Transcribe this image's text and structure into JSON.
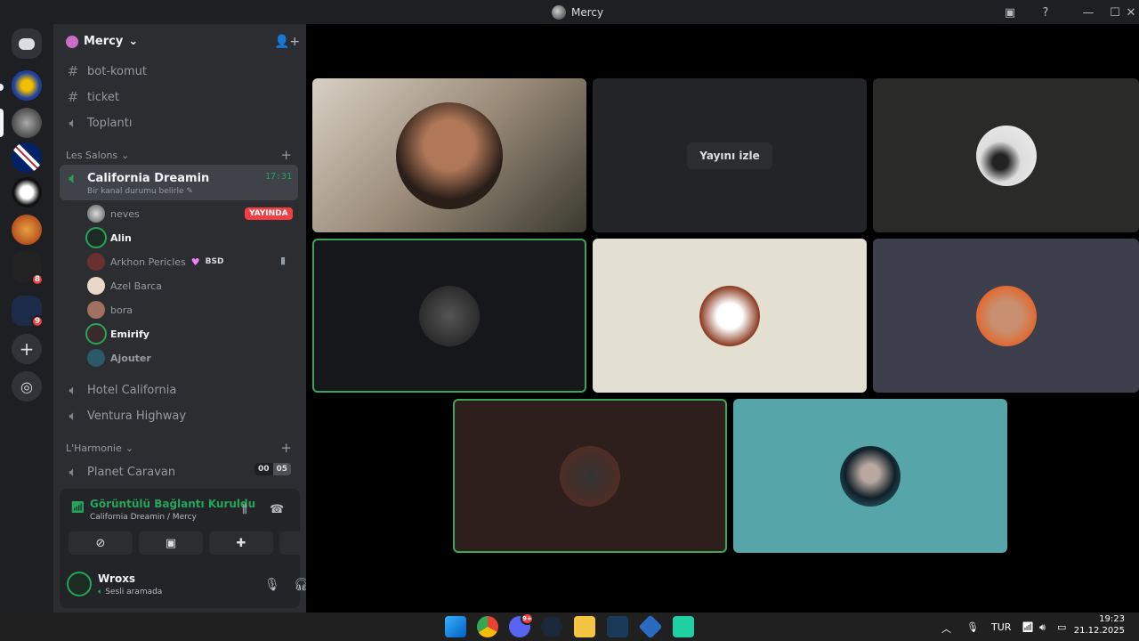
{
  "window": {
    "title": "Mercy"
  },
  "server": {
    "name": "Mercy"
  },
  "channels_top": [
    "bot-komut",
    "ticket",
    "Toplantı"
  ],
  "category1": {
    "name": "Les Salons"
  },
  "active_channel": {
    "name": "California Dreamin",
    "status": "Bir kanal durumu belirle",
    "time": "17:31"
  },
  "voice_users": [
    {
      "name": "neves",
      "live": "YAYINDA"
    },
    {
      "name": "Alin"
    },
    {
      "name": "Arkhon Pericles",
      "tag": "BSD"
    },
    {
      "name": "Azel Barca"
    },
    {
      "name": "bora"
    },
    {
      "name": "Emirify"
    },
    {
      "name": "Ajouter"
    }
  ],
  "channels_more": [
    "Hotel California",
    "Ventura Highway"
  ],
  "category2": {
    "name": "L'Harmonie"
  },
  "planet": {
    "name": "Planet Caravan",
    "count_a": "00",
    "count_b": "05"
  },
  "guild_badges": {
    "g6": "8",
    "g7": "9"
  },
  "voice_panel": {
    "title": "Görüntülü Bağlantı Kuruldu",
    "sub": "California Dreamin / Mercy"
  },
  "me": {
    "name": "Wroxs",
    "status": "Sesli aramada"
  },
  "stage": {
    "watch_label": "Yayını izle"
  },
  "taskbar": {
    "lang": "TUR",
    "time": "19:23",
    "date": "21.12.2025",
    "discord_badge": "9+"
  },
  "colors": {
    "green": "#23a55a",
    "live": "#f23f43",
    "bg": "#2b2d31"
  }
}
